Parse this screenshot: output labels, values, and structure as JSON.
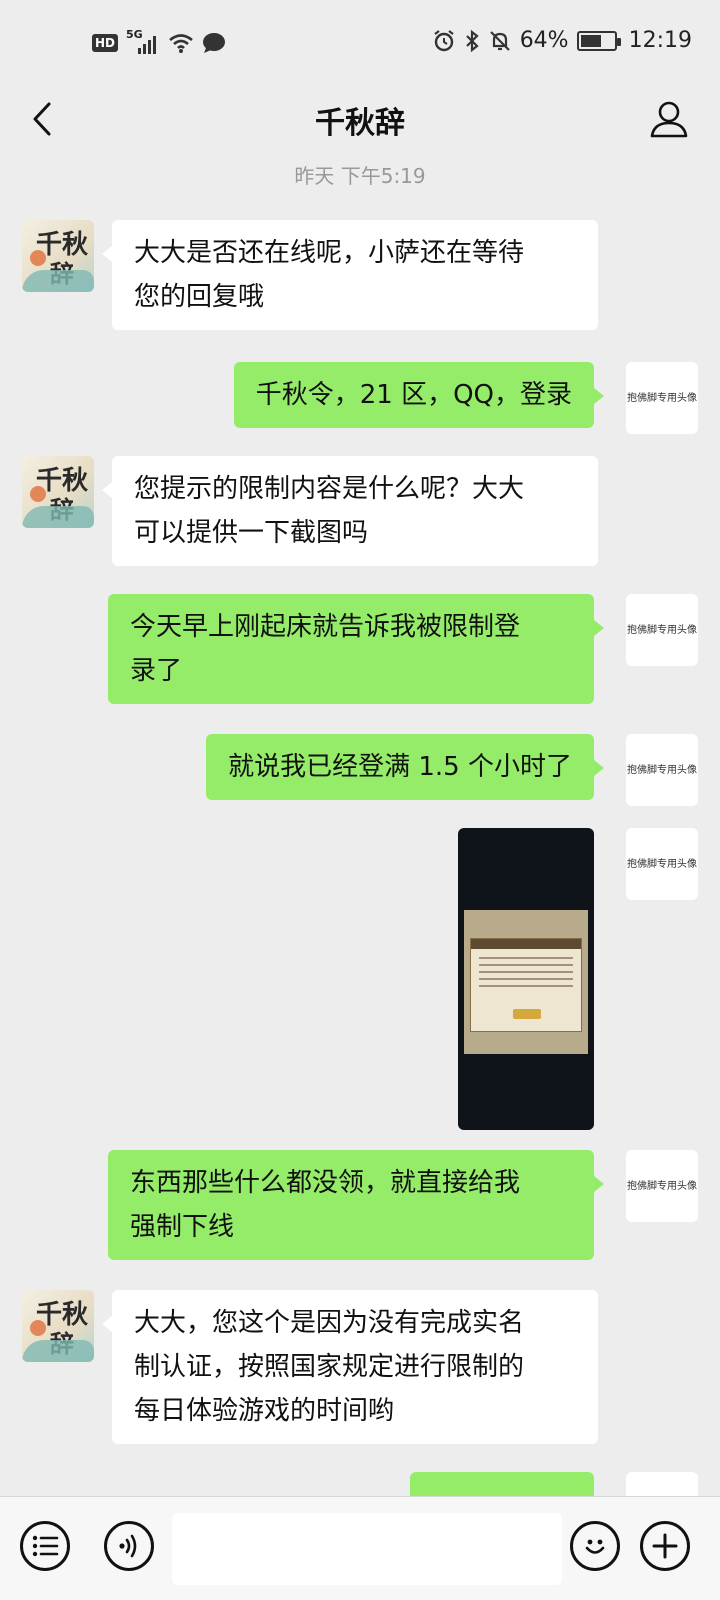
{
  "status_bar": {
    "hd": "HD",
    "network": "5G",
    "battery_percent_text": "64%",
    "battery_level": 0.64,
    "time": "12:19",
    "icons": [
      "signal-icon",
      "wifi-icon",
      "message-bubble-icon",
      "alarm-icon",
      "bluetooth-icon",
      "mute-bell-icon",
      "battery-icon"
    ]
  },
  "nav": {
    "title": "千秋辞",
    "back_icon": "chevron-left-icon",
    "profile_icon": "person-icon"
  },
  "timestamp": "昨天 下午5:19",
  "contact_avatar": {
    "glyph_top": "千秋",
    "glyph_bottom": "辞"
  },
  "my_avatar_text": "抱佛脚专用头像",
  "messages": [
    {
      "side": "in",
      "lines": [
        "大大是否还在线呢，小萨还在等待",
        "您的回复哦"
      ]
    },
    {
      "side": "out",
      "lines": [
        "千秋令，21 区，QQ，登录"
      ]
    },
    {
      "side": "in",
      "lines": [
        "您提示的限制内容是什么呢？大大",
        "可以提供一下截图吗"
      ]
    },
    {
      "side": "out",
      "lines": [
        "今天早上刚起床就告诉我被限制登",
        "录了"
      ]
    },
    {
      "side": "out",
      "lines": [
        "就说我已经登满 1.5 个小时了"
      ]
    },
    {
      "side": "out",
      "type": "image",
      "description_icon": "screenshot-image"
    },
    {
      "side": "out",
      "lines": [
        "东西那些什么都没领，就直接给我",
        "强制下线"
      ]
    },
    {
      "side": "in",
      "lines": [
        "大大，您这个是因为没有完成实名",
        "制认证，按照国家规定进行限制的",
        "每日体验游戏的时间哟"
      ]
    },
    {
      "side": "out",
      "lines": [
        ""
      ]
    }
  ],
  "input_bar": {
    "menu_icon": "list-menu-icon",
    "voice_icon": "voice-icon",
    "input_value": "",
    "emoji_icon": "smiley-icon",
    "plus_icon": "plus-icon"
  }
}
